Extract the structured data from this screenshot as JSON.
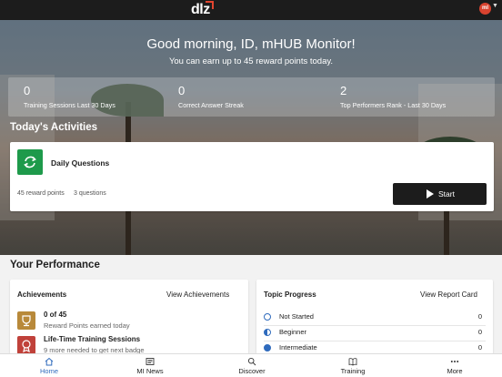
{
  "header": {
    "logo": "dlz",
    "avatar_initials": "mI"
  },
  "hero": {
    "greeting": "Good morning, ID, mHUB Monitor!",
    "subtitle": "You can earn up to 45 reward points today.",
    "stats": [
      {
        "value": "0",
        "label": "Training Sessions Last 30 Days"
      },
      {
        "value": "0",
        "label": "Correct Answer Streak"
      },
      {
        "value": "2",
        "label": "Top Performers Rank - Last 30 Days"
      }
    ]
  },
  "today": {
    "title": "Today's Activities",
    "activity": {
      "name": "Daily Questions",
      "points": "45 reward points",
      "questions": "3 questions",
      "start_label": "Start"
    }
  },
  "performance": {
    "title": "Your Performance",
    "achievements": {
      "title": "Achievements",
      "link": "View Achievements",
      "items": [
        {
          "main": "0 of 45",
          "sub": "Reward Points earned today",
          "icon": "trophy-icon",
          "color": "#b8893a"
        },
        {
          "main": "Life-Time Training Sessions",
          "sub": "9 more needed to get next badge",
          "icon": "badge-icon",
          "color": "#c0413a"
        }
      ]
    },
    "topics": {
      "title": "Topic Progress",
      "link": "View Report Card",
      "rows": [
        {
          "name": "Not Started",
          "count": "0"
        },
        {
          "name": "Beginner",
          "count": "0"
        },
        {
          "name": "Intermediate",
          "count": "0"
        }
      ]
    }
  },
  "nav": {
    "items": [
      {
        "label": "Home",
        "icon": "home-icon"
      },
      {
        "label": "MI News",
        "icon": "news-icon"
      },
      {
        "label": "Discover",
        "icon": "search-icon"
      },
      {
        "label": "Training",
        "icon": "book-icon"
      },
      {
        "label": "More",
        "icon": "more-icon"
      }
    ]
  },
  "colors": {
    "accent": "#2f6bbd",
    "brand_red": "#e2452f",
    "activity_green": "#1e9a4b"
  }
}
